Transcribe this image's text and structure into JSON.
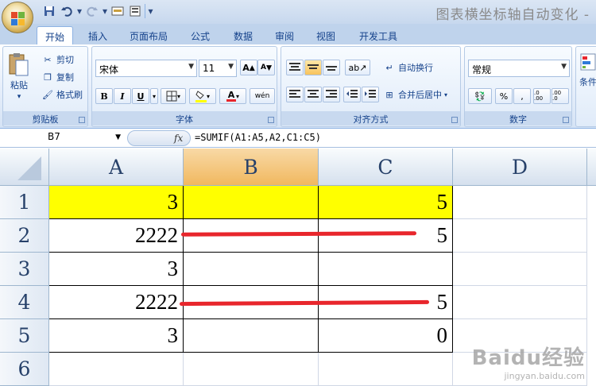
{
  "window": {
    "title": "图表横坐标轴自动变化 -"
  },
  "quick_access": {
    "save_icon": "save-icon",
    "undo_icon": "undo-icon",
    "redo_icon": "redo-icon",
    "dropdown_glyph": "▾"
  },
  "tabs": [
    "开始",
    "插入",
    "页面布局",
    "公式",
    "数据",
    "审阅",
    "视图",
    "开发工具"
  ],
  "active_tab": "开始",
  "ribbon": {
    "clipboard": {
      "label": "剪贴板",
      "paste": "粘贴",
      "cut": "剪切",
      "copy": "复制",
      "format_painter": "格式刷"
    },
    "font": {
      "label": "字体",
      "font_name": "宋体",
      "font_size": "11",
      "bold": "B",
      "italic": "I",
      "underline": "U",
      "phonetic": "wén"
    },
    "alignment": {
      "label": "对齐方式",
      "wrap_text": "自动换行",
      "merge_center": "合并后居中"
    },
    "number": {
      "label": "数字",
      "format": "常规",
      "percent": "%",
      "comma": ",",
      "inc_decimal": ".0 .00",
      "dec_decimal": ".00 .0"
    },
    "styles": {
      "conditional": "条件"
    }
  },
  "formula_bar": {
    "name_box": "B7",
    "fx": "fx",
    "formula": "=SUMIF(A1:A5,A2,C1:C5)"
  },
  "sheet": {
    "columns": [
      "A",
      "B",
      "C",
      "D"
    ],
    "selected_column": "B",
    "rows": [
      "1",
      "2",
      "3",
      "4",
      "5",
      "6"
    ],
    "cells": [
      [
        "3",
        "",
        "5",
        ""
      ],
      [
        "2222",
        "",
        "5",
        ""
      ],
      [
        "3",
        "",
        "",
        ""
      ],
      [
        "2222",
        "",
        "5",
        ""
      ],
      [
        "3",
        "",
        "0",
        ""
      ],
      [
        "",
        "",
        "",
        ""
      ]
    ],
    "highlight_color": "#ffff00",
    "annotation_color": "#e8262c"
  },
  "watermark": {
    "text": "Baidu经验",
    "url": "jingyan.baidu.com"
  }
}
